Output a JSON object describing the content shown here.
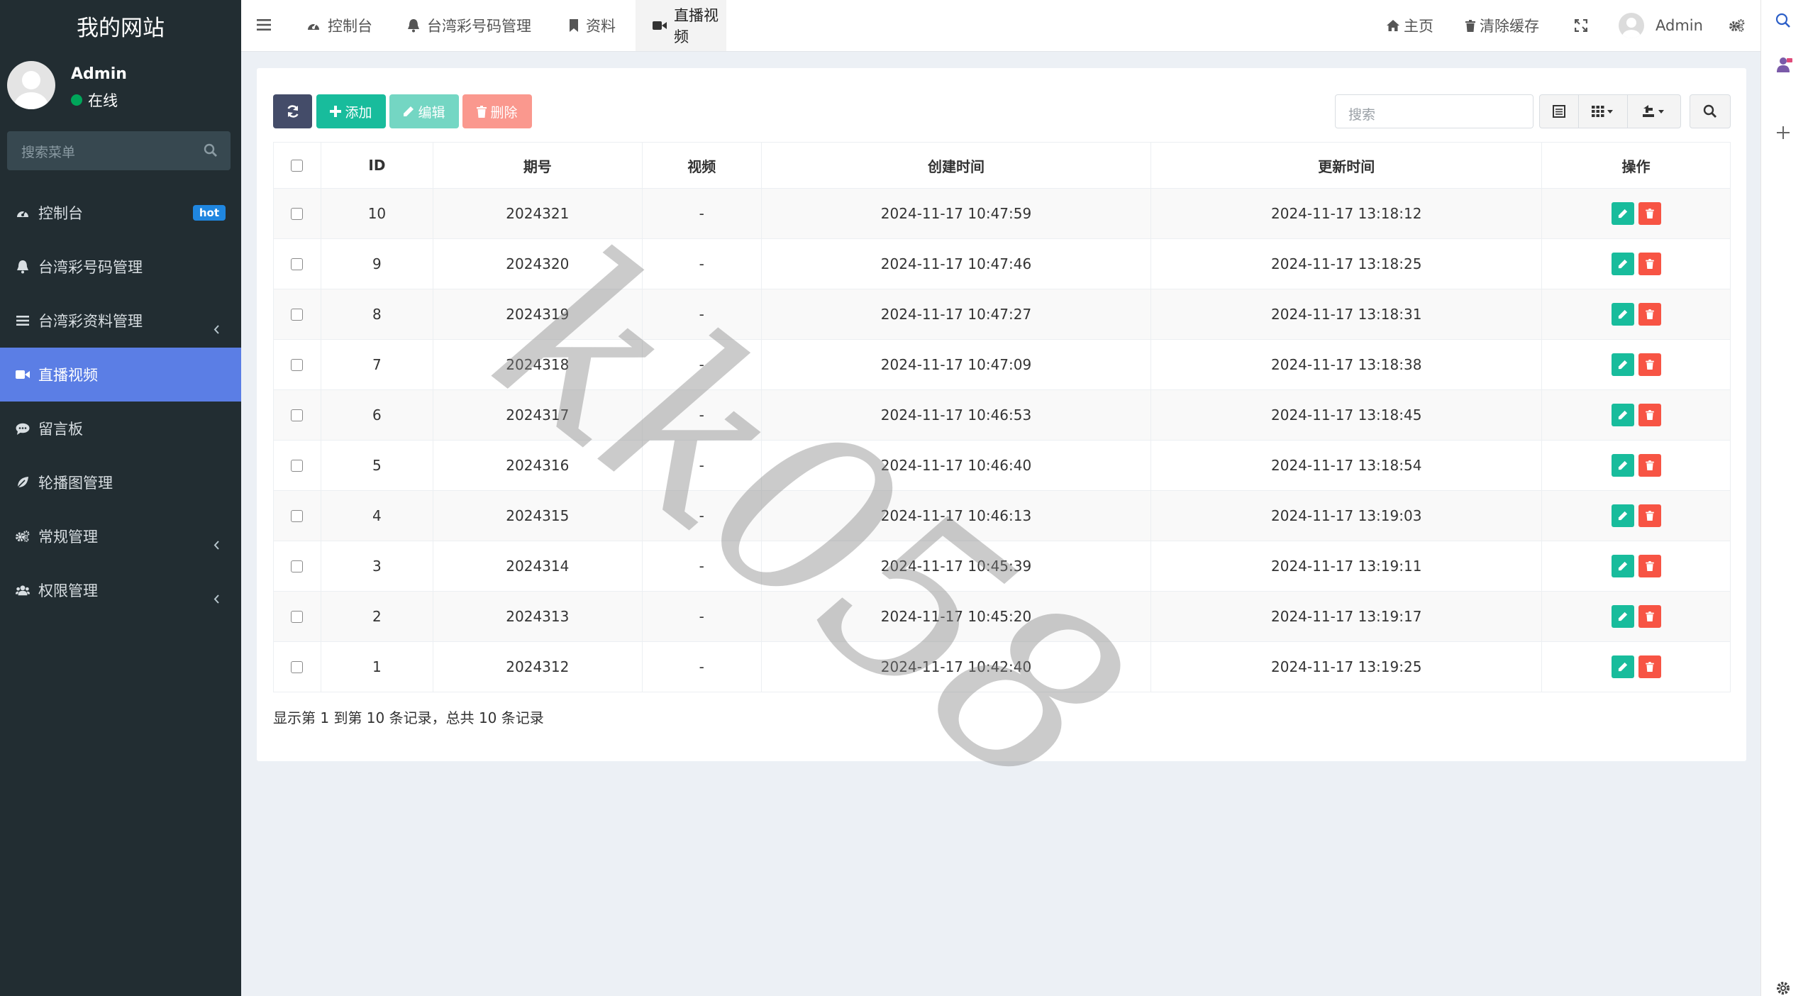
{
  "sidebar": {
    "site_title": "我的网站",
    "user": {
      "name": "Admin",
      "status": "在线"
    },
    "search_placeholder": "搜索菜单",
    "menu": [
      {
        "label": "控制台",
        "icon": "dashboard-icon",
        "badge": "hot"
      },
      {
        "label": "台湾彩号码管理",
        "icon": "bell-icon"
      },
      {
        "label": "台湾彩资料管理",
        "icon": "list-icon",
        "has_children": true
      },
      {
        "label": "直播视频",
        "icon": "video-icon",
        "active": true
      },
      {
        "label": "留言板",
        "icon": "comment-icon"
      },
      {
        "label": "轮播图管理",
        "icon": "leaf-icon"
      },
      {
        "label": "常规管理",
        "icon": "cogs-icon",
        "has_children": true
      },
      {
        "label": "权限管理",
        "icon": "users-icon",
        "has_children": true
      }
    ]
  },
  "topbar": {
    "tabs": [
      {
        "label": "控制台",
        "icon": "dashboard-icon"
      },
      {
        "label": "台湾彩号码管理",
        "icon": "bell-icon"
      },
      {
        "label": "资料",
        "icon": "bookmark-icon"
      },
      {
        "label": "直播视频",
        "icon": "video-icon",
        "active": true
      }
    ],
    "home": "主页",
    "clear_cache": "清除缓存",
    "admin": "Admin"
  },
  "toolbar": {
    "add": "添加",
    "edit": "编辑",
    "delete": "删除",
    "search_placeholder": "搜索"
  },
  "table": {
    "columns": [
      "ID",
      "期号",
      "视频",
      "创建时间",
      "更新时间",
      "操作"
    ],
    "rows": [
      {
        "id": "10",
        "issue": "2024321",
        "video": "-",
        "created": "2024-11-17 10:47:59",
        "updated": "2024-11-17 13:18:12"
      },
      {
        "id": "9",
        "issue": "2024320",
        "video": "-",
        "created": "2024-11-17 10:47:46",
        "updated": "2024-11-17 13:18:25"
      },
      {
        "id": "8",
        "issue": "2024319",
        "video": "-",
        "created": "2024-11-17 10:47:27",
        "updated": "2024-11-17 13:18:31"
      },
      {
        "id": "7",
        "issue": "2024318",
        "video": "-",
        "created": "2024-11-17 10:47:09",
        "updated": "2024-11-17 13:18:38"
      },
      {
        "id": "6",
        "issue": "2024317",
        "video": "-",
        "created": "2024-11-17 10:46:53",
        "updated": "2024-11-17 13:18:45"
      },
      {
        "id": "5",
        "issue": "2024316",
        "video": "-",
        "created": "2024-11-17 10:46:40",
        "updated": "2024-11-17 13:18:54"
      },
      {
        "id": "4",
        "issue": "2024315",
        "video": "-",
        "created": "2024-11-17 10:46:13",
        "updated": "2024-11-17 13:19:03"
      },
      {
        "id": "3",
        "issue": "2024314",
        "video": "-",
        "created": "2024-11-17 10:45:39",
        "updated": "2024-11-17 13:19:11"
      },
      {
        "id": "2",
        "issue": "2024313",
        "video": "-",
        "created": "2024-11-17 10:45:20",
        "updated": "2024-11-17 13:19:17"
      },
      {
        "id": "1",
        "issue": "2024312",
        "video": "-",
        "created": "2024-11-17 10:42:40",
        "updated": "2024-11-17 13:19:25"
      }
    ]
  },
  "pagination": {
    "summary": "显示第 1 到第 10 条记录，总共 10 条记录"
  },
  "watermark": "kk058",
  "colors": {
    "sidebar": "#222d32",
    "active": "#5b7ee5",
    "success": "#18bc9c",
    "danger": "#f75444",
    "primary_dark": "#444c69"
  }
}
